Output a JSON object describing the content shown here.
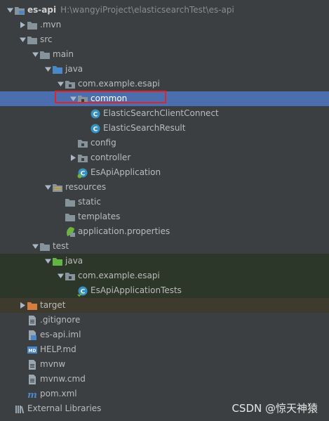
{
  "project": {
    "name": "es-api",
    "path": "H:\\wangyiProject\\elasticsearchTest\\es-api"
  },
  "tree": [
    {
      "label": "es-api",
      "depth": 0,
      "expanded": true,
      "icon": "module-folder-icon",
      "bold": true,
      "show_path": true
    },
    {
      "label": ".mvn",
      "depth": 1,
      "expanded": false,
      "icon": "folder-icon"
    },
    {
      "label": "src",
      "depth": 1,
      "expanded": true,
      "icon": "folder-icon"
    },
    {
      "label": "main",
      "depth": 2,
      "expanded": true,
      "icon": "folder-icon"
    },
    {
      "label": "java",
      "depth": 3,
      "expanded": true,
      "icon": "source-folder-icon"
    },
    {
      "label": "com.example.esapi",
      "depth": 4,
      "expanded": true,
      "icon": "package-icon"
    },
    {
      "label": "common",
      "depth": 5,
      "expanded": true,
      "icon": "package-icon",
      "selected": true
    },
    {
      "label": "ElasticSearchClientConnect",
      "depth": 6,
      "icon": "class-icon"
    },
    {
      "label": "ElasticSearchResult",
      "depth": 6,
      "icon": "class-icon"
    },
    {
      "label": "config",
      "depth": 5,
      "icon": "package-icon"
    },
    {
      "label": "controller",
      "depth": 5,
      "expanded": false,
      "icon": "package-icon"
    },
    {
      "label": "EsApiApplication",
      "depth": 5,
      "icon": "spring-boot-class-icon"
    },
    {
      "label": "resources",
      "depth": 3,
      "expanded": true,
      "icon": "resources-folder-icon"
    },
    {
      "label": "static",
      "depth": 4,
      "icon": "folder-icon"
    },
    {
      "label": "templates",
      "depth": 4,
      "icon": "folder-icon"
    },
    {
      "label": "application.properties",
      "depth": 4,
      "icon": "spring-properties-icon"
    },
    {
      "label": "test",
      "depth": 2,
      "expanded": true,
      "icon": "folder-icon"
    },
    {
      "label": "java",
      "depth": 3,
      "expanded": true,
      "icon": "test-source-folder-icon",
      "band": "test"
    },
    {
      "label": "com.example.esapi",
      "depth": 4,
      "expanded": true,
      "icon": "package-icon",
      "band": "test"
    },
    {
      "label": "EsApiApplicationTests",
      "depth": 5,
      "icon": "test-class-icon",
      "band": "test"
    },
    {
      "label": "target",
      "depth": 1,
      "expanded": false,
      "icon": "excluded-folder-icon",
      "band": "excluded"
    },
    {
      "label": ".gitignore",
      "depth": 1,
      "icon": "text-file-icon"
    },
    {
      "label": "es-api.iml",
      "depth": 1,
      "icon": "iml-file-icon"
    },
    {
      "label": "HELP.md",
      "depth": 1,
      "icon": "markdown-file-icon"
    },
    {
      "label": "mvnw",
      "depth": 1,
      "icon": "text-file-icon"
    },
    {
      "label": "mvnw.cmd",
      "depth": 1,
      "icon": "text-file-icon"
    },
    {
      "label": "pom.xml",
      "depth": 1,
      "icon": "maven-file-icon"
    },
    {
      "label": "External Libraries",
      "depth": 0,
      "expanded": false,
      "icon": "libraries-icon",
      "no_arrow": true
    }
  ],
  "watermark": "CSDN @惊天神猿",
  "colors": {
    "background": "#3c3f41",
    "selection": "#4b6eaf",
    "test_band": "#2c3629",
    "excluded_band": "#3f3a2e",
    "highlight_box": "#e0242b"
  }
}
